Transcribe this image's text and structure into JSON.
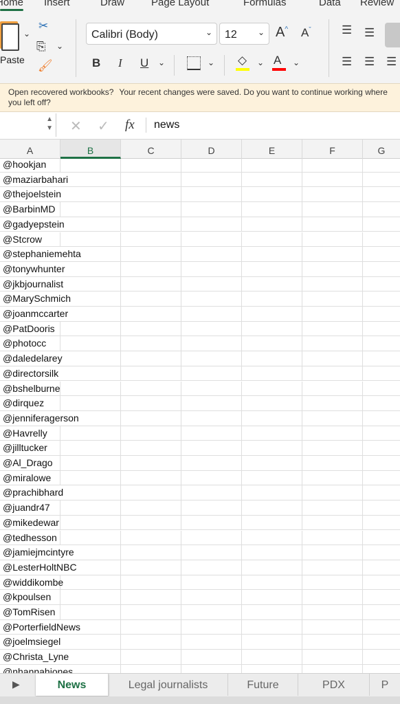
{
  "ribbon_tabs": [
    "Home",
    "Insert",
    "Draw",
    "Page Layout",
    "Formulas",
    "Data",
    "Review"
  ],
  "active_tab": "Home",
  "toolbar": {
    "paste_label": "Paste",
    "font_name": "Calibri (Body)",
    "font_size": "12",
    "bold": "B",
    "italic": "I",
    "underline": "U",
    "fill_color": "#ffff00",
    "font_color": "#ff0000"
  },
  "banner": {
    "title": "Open recovered workbooks?",
    "message": "Your recent changes were saved. Do you want to continue working where you left off?"
  },
  "formula_bar": {
    "name_box": "",
    "value": "news",
    "fx": "fx"
  },
  "columns": [
    "A",
    "B",
    "C",
    "D",
    "E",
    "F",
    "G"
  ],
  "selected_column": "B",
  "rows": [
    "@hookjan",
    "@maziarbahari",
    "@thejoelstein",
    "@BarbinMD",
    "@gadyepstein",
    "@Stcrow",
    "@stephaniemehta",
    "@tonywhunter",
    "@jkbjournalist",
    "@MarySchmich",
    "@joanmccarter",
    "@PatDooris",
    "@photocc",
    "@daledelarey",
    "@directorsilk",
    "@bshelburne",
    "@dirquez",
    "@jenniferagerson",
    "@Havrelly",
    "@jilltucker",
    "@Al_Drago",
    "@miralowe",
    "@prachibhard",
    "@juandr47",
    "@mikedewar",
    "@tedhesson",
    "@jamiejmcintyre",
    "@LesterHoltNBC",
    "@widdikombe",
    "@kpoulsen",
    "@TomRisen",
    "@PorterfieldNews",
    "@joelmsiegel",
    "@Christa_Lyne",
    "@nhannahjones"
  ],
  "sheet_tabs": [
    "News",
    "Legal journalists",
    "Future",
    "PDX",
    "P"
  ],
  "active_sheet": "News",
  "accent": "#1e7145"
}
